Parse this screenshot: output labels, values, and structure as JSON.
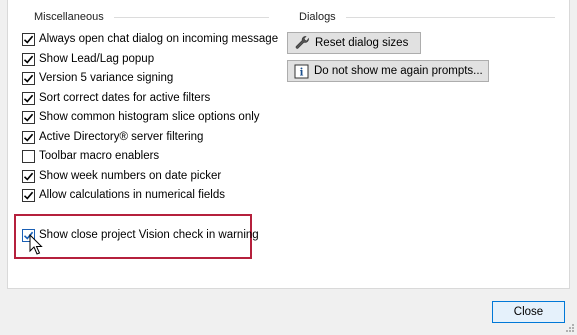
{
  "misc": {
    "header": "Miscellaneous",
    "options": [
      {
        "label": "Always open chat dialog on incoming message",
        "checked": true
      },
      {
        "label": "Show Lead/Lag popup",
        "checked": true
      },
      {
        "label": "Version 5 variance signing",
        "checked": true
      },
      {
        "label": "Sort correct dates for active filters",
        "checked": true
      },
      {
        "label": "Show common histogram slice options only",
        "checked": true
      },
      {
        "label": "Active Directory® server filtering",
        "checked": true
      },
      {
        "label": "Toolbar macro enablers",
        "checked": false
      },
      {
        "label": "Show week numbers on date picker",
        "checked": true
      },
      {
        "label": "Allow calculations in numerical fields",
        "checked": true
      }
    ],
    "highlighted": {
      "label": "Show close project Vision check in warning",
      "checked": true
    }
  },
  "dialogs": {
    "header": "Dialogs",
    "reset_label": "Reset dialog sizes",
    "prompts_label": "Do not show me again prompts..."
  },
  "footer": {
    "close_label": "Close"
  },
  "colors": {
    "highlight_border": "#b5203c",
    "close_border": "#0078d7",
    "check_mark": "#000000",
    "highlighted_check_mark": "#1a5fb4"
  }
}
